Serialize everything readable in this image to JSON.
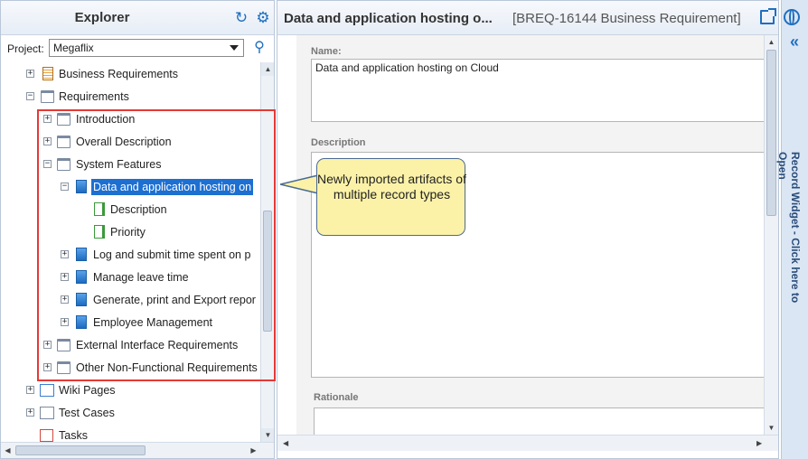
{
  "explorer": {
    "title": "Explorer",
    "refresh_icon": "refresh-icon",
    "settings_icon": "gear-icon",
    "project_label": "Project:",
    "project_value": "Megaflix",
    "search_icon": "search-icon"
  },
  "tree": {
    "items": [
      {
        "label": "Business Requirements",
        "icon": "business-requirements-icon"
      },
      {
        "label": "Requirements",
        "icon": "folder-icon"
      },
      {
        "label": "Introduction",
        "icon": "folder-icon"
      },
      {
        "label": "Overall Description",
        "icon": "folder-icon"
      },
      {
        "label": "System Features",
        "icon": "folder-icon"
      },
      {
        "label": "Data and application hosting on",
        "icon": "document-icon",
        "selected": true
      },
      {
        "label": "Description",
        "icon": "child-document-icon"
      },
      {
        "label": "Priority",
        "icon": "child-document-icon"
      },
      {
        "label": "Log and submit time spent on p",
        "icon": "document-icon"
      },
      {
        "label": "Manage leave time",
        "icon": "document-icon"
      },
      {
        "label": "Generate, print and Export repor",
        "icon": "document-icon"
      },
      {
        "label": "Employee Management",
        "icon": "document-icon"
      },
      {
        "label": "External Interface Requirements",
        "icon": "folder-icon"
      },
      {
        "label": "Other Non-Functional Requirements",
        "icon": "folder-icon"
      },
      {
        "label": "Wiki Pages",
        "icon": "wiki-icon"
      },
      {
        "label": "Test Cases",
        "icon": "test-cases-icon"
      },
      {
        "label": "Tasks",
        "icon": "tasks-icon"
      }
    ]
  },
  "record": {
    "title": "Data and application hosting o...",
    "id": "[BREQ-16144 Business Requirement]",
    "open_icon": "open-in-new-window-icon",
    "name_label": "Name:",
    "name_value": "Data and application hosting on Cloud",
    "description_label": "Description",
    "description_value": "",
    "rationale_label": "Rationale",
    "rationale_value": ""
  },
  "widget": {
    "globe_icon": "globe-icon",
    "collapse_icon": "double-chevron-left-icon",
    "text": "Record Widget - Click here to Open"
  },
  "callout": {
    "text": "Newly imported artifacts of multiple record types"
  },
  "colors": {
    "accent": "#1f6fc0",
    "selection": "#1d6fd1",
    "highlight_box": "#e53935",
    "callout_fill": "#fbf2a8"
  }
}
